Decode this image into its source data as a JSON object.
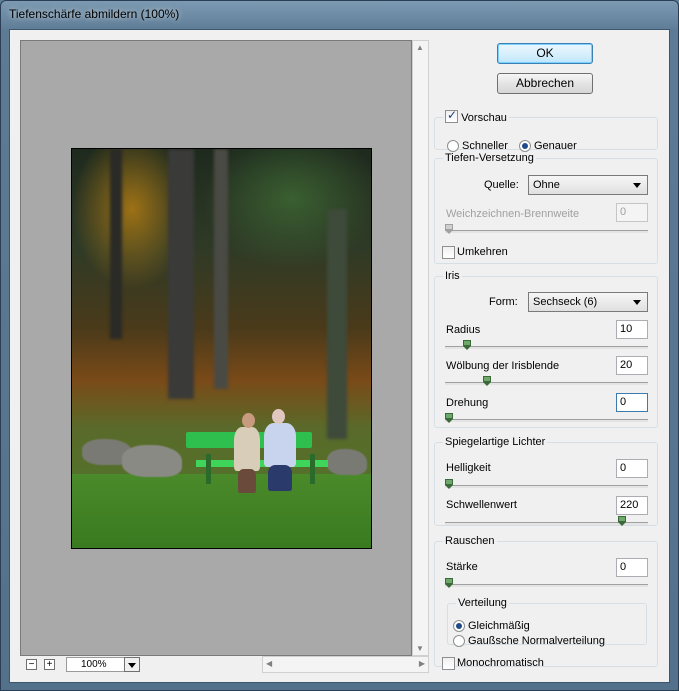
{
  "window": {
    "title": "Tiefenschärfe abmildern (100%)"
  },
  "preview": {
    "zoom_out_label": "−",
    "zoom_in_label": "+",
    "zoom_value": "100%"
  },
  "buttons": {
    "ok": "OK",
    "cancel": "Abbrechen"
  },
  "vorschau": {
    "checkbox_label": "Vorschau",
    "checked": true,
    "modes": [
      {
        "label": "Schneller",
        "selected": false
      },
      {
        "label": "Genauer",
        "selected": true
      }
    ]
  },
  "tiefen": {
    "legend": "Tiefen-Versetzung",
    "quelle_label": "Quelle:",
    "quelle_value": "Ohne",
    "brennweite_label": "Weichzeichnen-Brennweite",
    "brennweite_value": "0",
    "umkehren_label": "Umkehren",
    "umkehren_checked": false
  },
  "iris": {
    "legend": "Iris",
    "form_label": "Form:",
    "form_value": "Sechseck (6)",
    "radius_label": "Radius",
    "radius_value": "10",
    "woelbung_label": "Wölbung der Irisblende",
    "woelbung_value": "20",
    "drehung_label": "Drehung",
    "drehung_value": "0"
  },
  "spiegel": {
    "legend": "Spiegelartige Lichter",
    "helligkeit_label": "Helligkeit",
    "helligkeit_value": "0",
    "schwelle_label": "Schwellenwert",
    "schwelle_value": "220"
  },
  "rauschen": {
    "legend": "Rauschen",
    "staerke_label": "Stärke",
    "staerke_value": "0",
    "verteilung_legend": "Verteilung",
    "options": [
      {
        "label": "Gleichmäßig",
        "selected": true
      },
      {
        "label": "Gaußsche Normalverteilung",
        "selected": false
      }
    ],
    "mono_label": "Monochromatisch",
    "mono_checked": false
  }
}
